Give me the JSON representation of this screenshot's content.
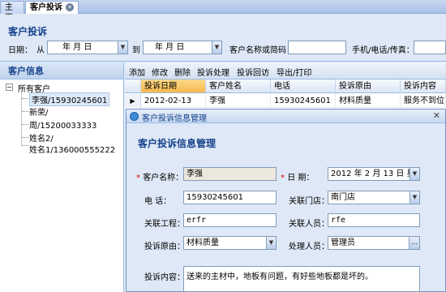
{
  "tabs": [
    {
      "label": "主页"
    },
    {
      "label": "客户投诉"
    }
  ],
  "query": {
    "title": "客户投诉",
    "date_label": "日期：",
    "from_label": "从",
    "date_from": "年   月   日",
    "to_label": "到",
    "date_to": "年   月   日",
    "name_label": "客户名称或简码：",
    "name_value": "",
    "phone_label": "手机/电话/传真：",
    "phone_value": ""
  },
  "left_panel": {
    "title": "客户信息",
    "root": "所有客户",
    "nodes": [
      {
        "label": "李强/15930245601"
      },
      {
        "label": "新荣/"
      },
      {
        "label": "周/15200033333"
      },
      {
        "label": "姓名2/"
      },
      {
        "label": "姓名1/136000555222"
      }
    ]
  },
  "toolbar": {
    "items": [
      "添加",
      "修改",
      "删除",
      "投诉处理",
      "投诉回访",
      "导出/打印"
    ]
  },
  "grid": {
    "columns": [
      "投诉日期",
      "客户姓名",
      "电话",
      "投诉原由",
      "投诉内容"
    ],
    "rows": [
      [
        "2012-02-13",
        "李强",
        "15930245601",
        "材料质量",
        "服务不到位"
      ]
    ]
  },
  "dialog": {
    "title": "客户投诉信息管理",
    "subtitle": "客户投诉信息管理",
    "fields": {
      "customer_name_label": "客户名称：",
      "customer_name": "李强",
      "date_label": "日  期：",
      "date_value": "2012 年 2 月 13 日 星",
      "phone_label": "电    话：",
      "phone_value": "15930245601",
      "store_label": "关联门店：",
      "store_value": "南门店",
      "project_label": "关联工程：",
      "project_value": "erfr",
      "staff_label": "关联人员：",
      "staff_value": "rfe",
      "reason_label": "投诉原由：",
      "reason_value": "材料质量",
      "handler_label": "处理人员：",
      "handler_value": "管理员",
      "content_label": "投诉内容：",
      "content_value": "送来的主材中，地板有问题，有好些地板都是坏的。"
    }
  }
}
